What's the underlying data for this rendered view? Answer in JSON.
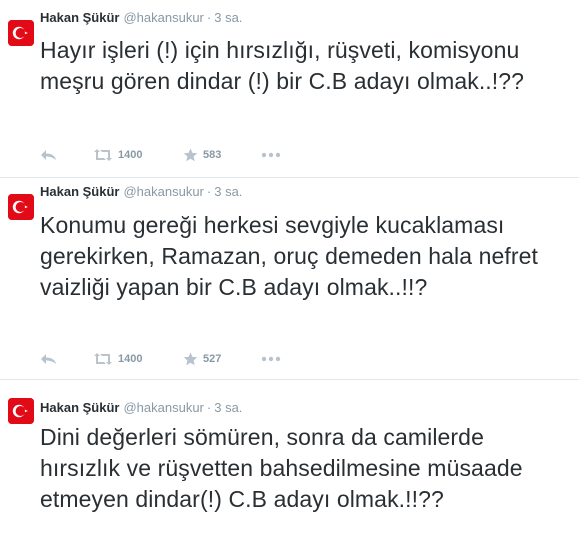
{
  "tweets": [
    {
      "author": "Hakan Şükür",
      "handle": "@hakansukur",
      "separator": "·",
      "time": "3 sa.",
      "text": "Hayır işleri (!) için hırsızlığı, rüşveti, komisyonu meşru gören dindar (!) bir C.B adayı olmak..!??",
      "retweets": "1400",
      "favorites": "583"
    },
    {
      "author": "Hakan Şükür",
      "handle": "@hakansukur",
      "separator": "·",
      "time": "3 sa.",
      "text": "Konumu gereği herkesi sevgiyle kucaklaması gerekirken, Ramazan, oruç demeden hala nefret vaizliği yapan bir C.B adayı olmak..!!?",
      "retweets": "1400",
      "favorites": "527"
    },
    {
      "author": "Hakan Şükür",
      "handle": "@hakansukur",
      "separator": "·",
      "time": "3 sa.",
      "text": "Dini değerleri sömüren, sonra da camilerde hırsızlık ve rüşvetten bahsedilmesine müsaade etmeyen dindar(!) C.B adayı olmak.!!??"
    }
  ],
  "icons": {
    "avatar": "turkish-flag-icon",
    "reply": "reply-icon",
    "retweet": "retweet-icon",
    "favorite": "star-icon",
    "more": "more-icon"
  },
  "colors": {
    "name": "#292f33",
    "meta": "#8899a6",
    "icon": "#b8c3cb",
    "divider": "#e1e8ed",
    "flag": "#e30a17"
  }
}
